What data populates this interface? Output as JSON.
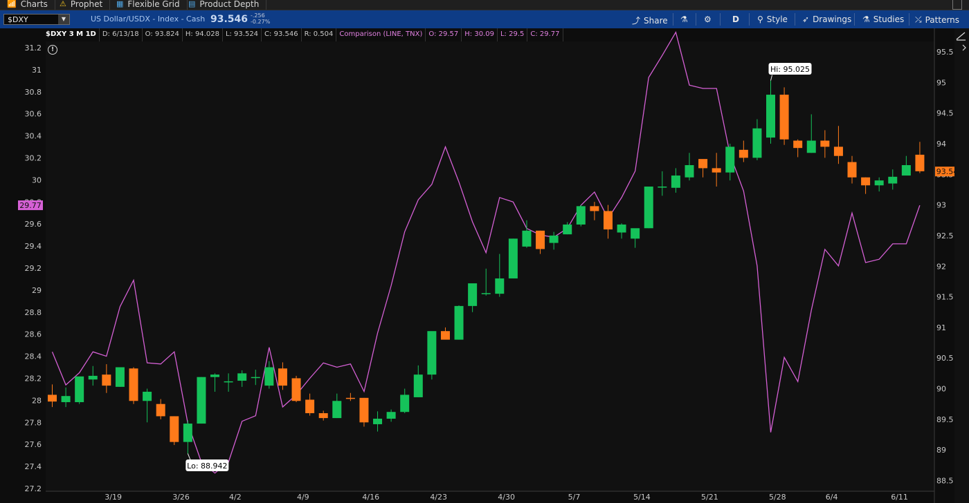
{
  "tabs": [
    {
      "icon": "chart-icon",
      "glyph": "📶",
      "label": "Charts"
    },
    {
      "icon": "prophet-icon",
      "glyph": "⚠",
      "label": "Prophet"
    },
    {
      "icon": "grid-icon",
      "glyph": "▦",
      "label": "Flexible Grid"
    },
    {
      "icon": "depth-icon",
      "glyph": "▤",
      "label": "Product Depth"
    }
  ],
  "toolbar": {
    "symbol": "$DXY",
    "description": "US Dollar/USDX - Index - Cash",
    "last_price": "93.546",
    "net_change": "-.256",
    "pct_change": "-0.27%",
    "buttons": [
      {
        "name": "share",
        "glyph": "⤴",
        "label": "Share"
      },
      {
        "name": "flask",
        "glyph": "⚗",
        "label": ""
      },
      {
        "name": "settings",
        "glyph": "⚙",
        "label": ""
      },
      {
        "name": "aggregation",
        "glyph": "",
        "label": "D"
      },
      {
        "name": "style",
        "glyph": "⚲",
        "label": "Style"
      },
      {
        "name": "drawings",
        "glyph": "➶",
        "label": "Drawings"
      },
      {
        "name": "studies",
        "glyph": "⚗",
        "label": "Studies"
      },
      {
        "name": "patterns",
        "glyph": "⤯",
        "label": "Patterns"
      }
    ]
  },
  "infobar": {
    "symbol": "$DXY 3 M 1D",
    "date": "D: 6/13/18",
    "open": "O: 93.824",
    "high": "H: 94.028",
    "low": "L: 93.524",
    "close": "C: 93.546",
    "range": "R: 0.504",
    "comparison": "Comparison (LINE, TNX)",
    "cmp_open": "O: 29.57",
    "cmp_high": "H: 30.09",
    "cmp_low": "L: 29.5",
    "cmp_close": "C: 29.77"
  },
  "colors": {
    "up": "#15c25a",
    "down": "#ff7a1a",
    "comparison": "#d560d5",
    "background": "#0d0d0d"
  },
  "chart_data": {
    "type": "candlestick",
    "symbol": "$DXY",
    "left_axis": {
      "min": 27.2,
      "max": 31.2,
      "ticks": [
        "27.2",
        "27.4",
        "27.6",
        "27.8",
        "28",
        "28.2",
        "28.4",
        "28.6",
        "28.8",
        "29",
        "29.2",
        "29.4",
        "29.6",
        "29.8",
        "30",
        "30.2",
        "30.4",
        "30.6",
        "30.8",
        "31",
        "31.2"
      ]
    },
    "right_axis": {
      "min": 88.35,
      "max": 95.65,
      "ticks": [
        "88.5",
        "89",
        "89.5",
        "90",
        "90.5",
        "91",
        "91.5",
        "92",
        "92.5",
        "93",
        "93.5",
        "94",
        "94.5",
        "95",
        "95.5"
      ]
    },
    "x_labels": [
      "3/19",
      "3/26",
      "4/2",
      "4/9",
      "4/16",
      "4/23",
      "4/30",
      "5/7",
      "5/14",
      "5/21",
      "5/28",
      "6/4",
      "6/11"
    ],
    "label_after_index": [
      4,
      9,
      13,
      18,
      23,
      28,
      33,
      38,
      43,
      48,
      53,
      57,
      62
    ],
    "candles": [
      [
        89.9,
        90.07,
        89.7,
        89.79
      ],
      [
        89.78,
        90.02,
        89.7,
        89.88
      ],
      [
        89.78,
        90.13,
        89.75,
        90.2
      ],
      [
        90.15,
        90.37,
        90.05,
        90.21
      ],
      [
        90.23,
        90.4,
        89.93,
        90.05
      ],
      [
        90.03,
        90.35,
        90.03,
        90.35
      ],
      [
        90.33,
        90.35,
        89.75,
        89.8
      ],
      [
        89.8,
        90.0,
        89.45,
        89.95
      ],
      [
        89.75,
        89.83,
        89.5,
        89.55
      ],
      [
        89.55,
        89.55,
        89.08,
        89.13
      ],
      [
        89.13,
        89.48,
        88.94,
        89.43
      ],
      [
        89.43,
        90.19,
        89.43,
        90.19
      ],
      [
        90.19,
        90.25,
        89.95,
        90.23
      ],
      [
        90.12,
        90.25,
        89.95,
        90.12
      ],
      [
        90.13,
        90.3,
        90.03,
        90.25
      ],
      [
        90.18,
        90.31,
        90.06,
        90.19
      ],
      [
        90.05,
        90.45,
        90.0,
        90.35
      ],
      [
        90.33,
        90.43,
        89.98,
        90.05
      ],
      [
        90.17,
        90.21,
        89.78,
        89.8
      ],
      [
        89.82,
        89.92,
        89.56,
        89.6
      ],
      [
        89.6,
        89.64,
        89.48,
        89.52
      ],
      [
        89.52,
        89.92,
        89.52,
        89.8
      ],
      [
        89.85,
        89.93,
        89.8,
        89.84
      ],
      [
        89.85,
        89.85,
        89.38,
        89.45
      ],
      [
        89.42,
        89.63,
        89.3,
        89.51
      ],
      [
        89.51,
        89.66,
        89.46,
        89.62
      ],
      [
        89.62,
        90.0,
        89.6,
        89.9
      ],
      [
        89.86,
        90.38,
        89.86,
        90.23
      ],
      [
        90.23,
        90.61,
        90.15,
        90.94
      ],
      [
        90.94,
        91.0,
        90.85,
        90.8
      ],
      [
        90.8,
        91.36,
        90.8,
        91.35
      ],
      [
        91.35,
        91.62,
        91.25,
        91.72
      ],
      [
        91.56,
        91.96,
        91.52,
        91.56
      ],
      [
        91.55,
        92.2,
        91.5,
        91.8
      ],
      [
        91.8,
        92.45,
        91.8,
        92.45
      ],
      [
        92.32,
        92.75,
        92.3,
        92.58
      ],
      [
        92.58,
        92.58,
        92.2,
        92.28
      ],
      [
        92.38,
        92.56,
        92.27,
        92.5
      ],
      [
        92.52,
        92.72,
        92.52,
        92.68
      ],
      [
        92.68,
        93.0,
        92.65,
        92.98
      ],
      [
        92.98,
        93.05,
        92.75,
        92.9
      ],
      [
        92.9,
        93.0,
        92.45,
        92.6
      ],
      [
        92.55,
        92.7,
        92.45,
        92.68
      ],
      [
        92.45,
        92.6,
        92.3,
        92.62
      ],
      [
        92.62,
        93.3,
        92.62,
        93.3
      ],
      [
        93.3,
        93.55,
        93.15,
        93.3
      ],
      [
        93.28,
        93.6,
        93.2,
        93.48
      ],
      [
        93.45,
        93.85,
        93.4,
        93.65
      ],
      [
        93.75,
        93.65,
        93.45,
        93.6
      ],
      [
        93.6,
        93.85,
        93.3,
        93.53
      ],
      [
        93.53,
        94.0,
        93.4,
        93.95
      ],
      [
        93.9,
        94.05,
        93.7,
        93.77
      ],
      [
        93.77,
        94.4,
        93.73,
        94.25
      ],
      [
        94.1,
        95.03,
        94.0,
        94.8
      ],
      [
        94.8,
        94.92,
        93.98,
        94.07
      ],
      [
        94.05,
        94.07,
        93.78,
        93.93
      ],
      [
        93.85,
        94.48,
        93.85,
        94.05
      ],
      [
        94.05,
        94.22,
        93.77,
        93.95
      ],
      [
        93.95,
        94.29,
        93.67,
        93.8
      ],
      [
        93.7,
        93.8,
        93.35,
        93.45
      ],
      [
        93.45,
        93.45,
        93.18,
        93.32
      ],
      [
        93.32,
        93.45,
        93.22,
        93.4
      ],
      [
        93.35,
        93.58,
        93.25,
        93.46
      ],
      [
        93.48,
        93.8,
        93.52,
        93.65
      ],
      [
        93.82,
        94.03,
        93.52,
        93.55
      ]
    ],
    "comparison": {
      "name": "TNX",
      "values": [
        28.44,
        28.14,
        28.25,
        28.44,
        28.4,
        28.85,
        29.09,
        28.34,
        28.33,
        28.44,
        27.79,
        27.44,
        27.34,
        27.44,
        27.81,
        27.86,
        28.48,
        27.94,
        28.05,
        28.2,
        28.34,
        28.3,
        28.33,
        28.08,
        28.61,
        29.04,
        29.53,
        29.82,
        29.96,
        30.3,
        29.98,
        29.62,
        29.34,
        29.84,
        29.8,
        29.56,
        29.5,
        29.48,
        29.56,
        29.77,
        29.89,
        29.65,
        29.84,
        30.08,
        30.93,
        31.13,
        31.34,
        30.86,
        30.83,
        30.83,
        30.23,
        29.9,
        29.22,
        27.71,
        28.39,
        28.17,
        28.82,
        29.37,
        29.22,
        29.7,
        29.25,
        29.28,
        29.42,
        29.42,
        29.77
      ]
    },
    "annotations": {
      "high_label": "Hi: 95.025",
      "low_label": "Lo: 88.942",
      "high_index": 53,
      "low_index": 10
    },
    "price_tag": "93.546",
    "comparison_tag": "29.77"
  }
}
